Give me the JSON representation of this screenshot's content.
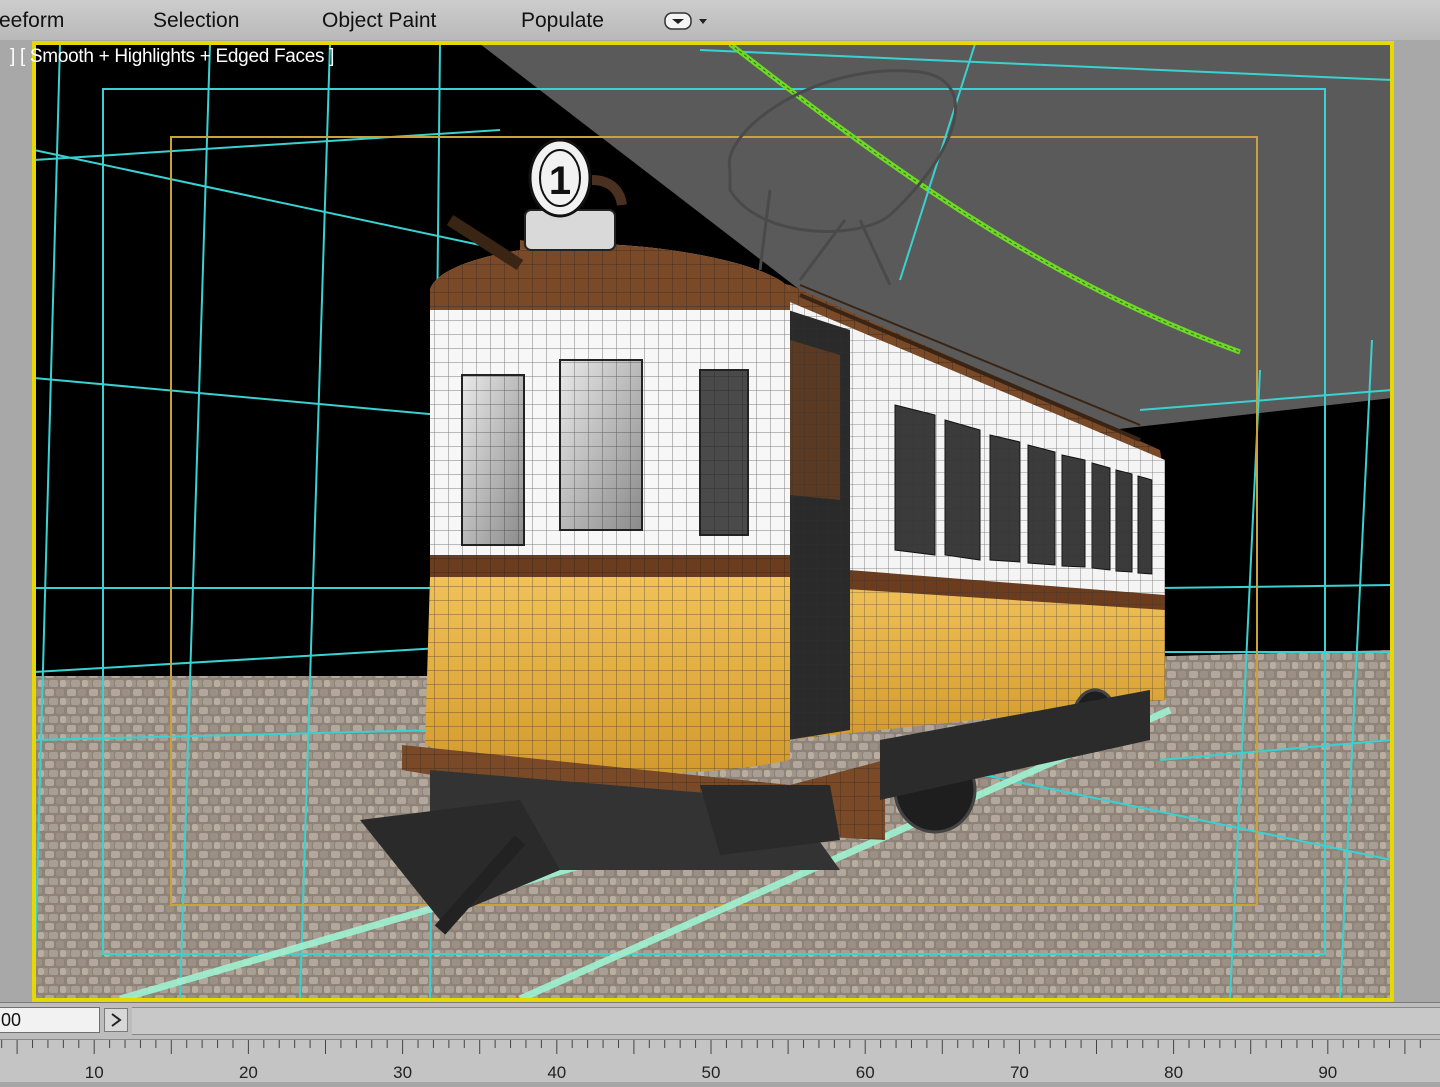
{
  "ribbon": {
    "tabs": [
      {
        "label": "reeform"
      },
      {
        "label": "Selection"
      },
      {
        "label": "Object Paint"
      },
      {
        "label": "Populate"
      }
    ],
    "options_icon": "dropdown-options-icon"
  },
  "viewport": {
    "label": "] [ Smooth + Highlights + Edged Faces ]",
    "tram_number": "1"
  },
  "timeline": {
    "frame_value": "00",
    "next_button": ">",
    "ruler_labels": [
      "10",
      "20",
      "30",
      "40",
      "50",
      "60",
      "70",
      "80",
      "90"
    ]
  },
  "colors": {
    "viewport_border": "#e6d800",
    "safe_frame": "#3ad1d1",
    "render_region": "#c9a23a",
    "tram_body_lower": "#e8b446",
    "tram_trim": "#6b3d1e",
    "trolley_wire": "#6fd826"
  }
}
